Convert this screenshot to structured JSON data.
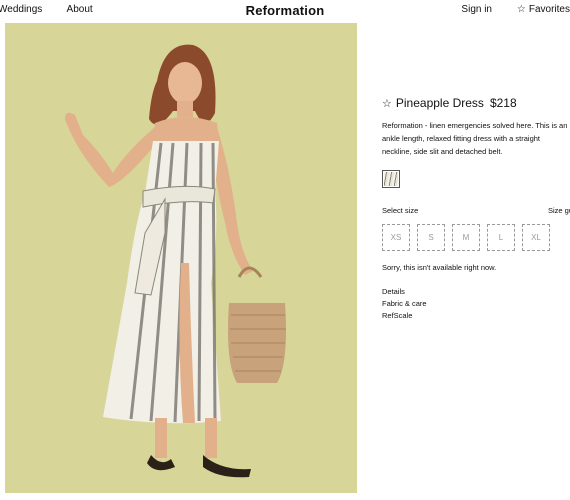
{
  "nav": {
    "left_items": [
      "Weddings",
      "About"
    ],
    "logo": "Reformation",
    "signin": "Sign in",
    "favorites": "Favorites"
  },
  "product": {
    "title": "Pineapple Dress",
    "price": "$218",
    "description": "Reformation - linen emergencies solved here. This is an ankle length, relaxed fitting dress with a straight neckline, side slit and detached belt.",
    "select_size_label": "Select size",
    "size_guide_label": "Size guide",
    "sizes": [
      "XS",
      "S",
      "M",
      "L",
      "XL"
    ],
    "availability": "Sorry, this isn't available right now.",
    "links": [
      "Details",
      "Fabric & care",
      "RefScale"
    ]
  },
  "colors": {
    "photo_background": "#d7d598",
    "size_border": "#9a9a9a"
  }
}
